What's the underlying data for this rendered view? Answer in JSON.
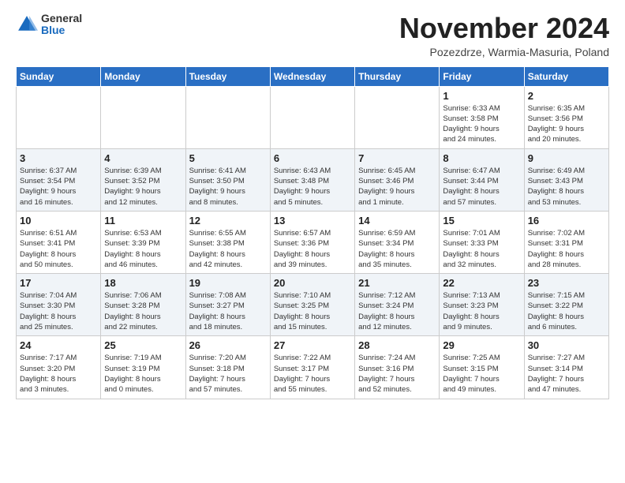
{
  "header": {
    "logo_general": "General",
    "logo_blue": "Blue",
    "month_title": "November 2024",
    "subtitle": "Pozezdrze, Warmia-Masuria, Poland"
  },
  "days_of_week": [
    "Sunday",
    "Monday",
    "Tuesday",
    "Wednesday",
    "Thursday",
    "Friday",
    "Saturday"
  ],
  "weeks": [
    [
      {
        "day": "",
        "detail": ""
      },
      {
        "day": "",
        "detail": ""
      },
      {
        "day": "",
        "detail": ""
      },
      {
        "day": "",
        "detail": ""
      },
      {
        "day": "",
        "detail": ""
      },
      {
        "day": "1",
        "detail": "Sunrise: 6:33 AM\nSunset: 3:58 PM\nDaylight: 9 hours\nand 24 minutes."
      },
      {
        "day": "2",
        "detail": "Sunrise: 6:35 AM\nSunset: 3:56 PM\nDaylight: 9 hours\nand 20 minutes."
      }
    ],
    [
      {
        "day": "3",
        "detail": "Sunrise: 6:37 AM\nSunset: 3:54 PM\nDaylight: 9 hours\nand 16 minutes."
      },
      {
        "day": "4",
        "detail": "Sunrise: 6:39 AM\nSunset: 3:52 PM\nDaylight: 9 hours\nand 12 minutes."
      },
      {
        "day": "5",
        "detail": "Sunrise: 6:41 AM\nSunset: 3:50 PM\nDaylight: 9 hours\nand 8 minutes."
      },
      {
        "day": "6",
        "detail": "Sunrise: 6:43 AM\nSunset: 3:48 PM\nDaylight: 9 hours\nand 5 minutes."
      },
      {
        "day": "7",
        "detail": "Sunrise: 6:45 AM\nSunset: 3:46 PM\nDaylight: 9 hours\nand 1 minute."
      },
      {
        "day": "8",
        "detail": "Sunrise: 6:47 AM\nSunset: 3:44 PM\nDaylight: 8 hours\nand 57 minutes."
      },
      {
        "day": "9",
        "detail": "Sunrise: 6:49 AM\nSunset: 3:43 PM\nDaylight: 8 hours\nand 53 minutes."
      }
    ],
    [
      {
        "day": "10",
        "detail": "Sunrise: 6:51 AM\nSunset: 3:41 PM\nDaylight: 8 hours\nand 50 minutes."
      },
      {
        "day": "11",
        "detail": "Sunrise: 6:53 AM\nSunset: 3:39 PM\nDaylight: 8 hours\nand 46 minutes."
      },
      {
        "day": "12",
        "detail": "Sunrise: 6:55 AM\nSunset: 3:38 PM\nDaylight: 8 hours\nand 42 minutes."
      },
      {
        "day": "13",
        "detail": "Sunrise: 6:57 AM\nSunset: 3:36 PM\nDaylight: 8 hours\nand 39 minutes."
      },
      {
        "day": "14",
        "detail": "Sunrise: 6:59 AM\nSunset: 3:34 PM\nDaylight: 8 hours\nand 35 minutes."
      },
      {
        "day": "15",
        "detail": "Sunrise: 7:01 AM\nSunset: 3:33 PM\nDaylight: 8 hours\nand 32 minutes."
      },
      {
        "day": "16",
        "detail": "Sunrise: 7:02 AM\nSunset: 3:31 PM\nDaylight: 8 hours\nand 28 minutes."
      }
    ],
    [
      {
        "day": "17",
        "detail": "Sunrise: 7:04 AM\nSunset: 3:30 PM\nDaylight: 8 hours\nand 25 minutes."
      },
      {
        "day": "18",
        "detail": "Sunrise: 7:06 AM\nSunset: 3:28 PM\nDaylight: 8 hours\nand 22 minutes."
      },
      {
        "day": "19",
        "detail": "Sunrise: 7:08 AM\nSunset: 3:27 PM\nDaylight: 8 hours\nand 18 minutes."
      },
      {
        "day": "20",
        "detail": "Sunrise: 7:10 AM\nSunset: 3:25 PM\nDaylight: 8 hours\nand 15 minutes."
      },
      {
        "day": "21",
        "detail": "Sunrise: 7:12 AM\nSunset: 3:24 PM\nDaylight: 8 hours\nand 12 minutes."
      },
      {
        "day": "22",
        "detail": "Sunrise: 7:13 AM\nSunset: 3:23 PM\nDaylight: 8 hours\nand 9 minutes."
      },
      {
        "day": "23",
        "detail": "Sunrise: 7:15 AM\nSunset: 3:22 PM\nDaylight: 8 hours\nand 6 minutes."
      }
    ],
    [
      {
        "day": "24",
        "detail": "Sunrise: 7:17 AM\nSunset: 3:20 PM\nDaylight: 8 hours\nand 3 minutes."
      },
      {
        "day": "25",
        "detail": "Sunrise: 7:19 AM\nSunset: 3:19 PM\nDaylight: 8 hours\nand 0 minutes."
      },
      {
        "day": "26",
        "detail": "Sunrise: 7:20 AM\nSunset: 3:18 PM\nDaylight: 7 hours\nand 57 minutes."
      },
      {
        "day": "27",
        "detail": "Sunrise: 7:22 AM\nSunset: 3:17 PM\nDaylight: 7 hours\nand 55 minutes."
      },
      {
        "day": "28",
        "detail": "Sunrise: 7:24 AM\nSunset: 3:16 PM\nDaylight: 7 hours\nand 52 minutes."
      },
      {
        "day": "29",
        "detail": "Sunrise: 7:25 AM\nSunset: 3:15 PM\nDaylight: 7 hours\nand 49 minutes."
      },
      {
        "day": "30",
        "detail": "Sunrise: 7:27 AM\nSunset: 3:14 PM\nDaylight: 7 hours\nand 47 minutes."
      }
    ]
  ]
}
